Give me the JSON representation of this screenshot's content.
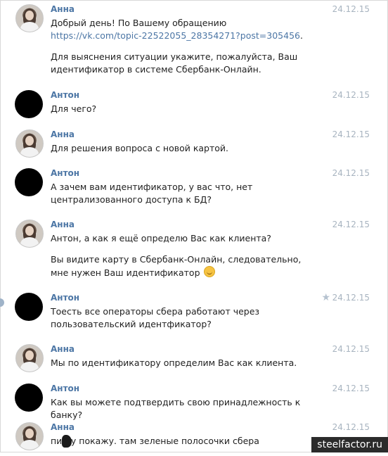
{
  "messages": [
    {
      "author": "Анна",
      "date": "24.12.15",
      "lines": [
        {
          "pre": "Добрый день! По Вашему обращению ",
          "link": "https://vk.com/topic-22522055_28354271?post=305456",
          "post": "."
        },
        {
          "text": "Для выяснения ситуации укажите, пожалуйста, Ваш идентификатор в системе Сбербанк-Онлайн."
        }
      ]
    },
    {
      "author": "Антон",
      "date": "24.12.15",
      "lines": [
        {
          "text": "Для чего?"
        }
      ]
    },
    {
      "author": "Анна",
      "date": "24.12.15",
      "lines": [
        {
          "text": "Для решения вопроса с новой картой."
        }
      ]
    },
    {
      "author": "Антон",
      "date": "24.12.15",
      "lines": [
        {
          "text": "А зачем вам идентификатор, у вас что, нет централизованного доступа к БД?"
        }
      ]
    },
    {
      "author": "Анна",
      "date": "24.12.15",
      "lines": [
        {
          "text": "Антон, а как я ещё определю Вас как клиента?"
        },
        {
          "text": "Вы видите карту в Сбербанк-Онлайн, следовательно, мне нужен Ваш идентификатор",
          "emoji": "smile-emoji"
        }
      ]
    },
    {
      "author": "Антон",
      "date": "24.12.15",
      "starred": true,
      "lines": [
        {
          "text": "Тоесть все операторы сбера работают через пользовательский идентфикатор?"
        }
      ]
    },
    {
      "author": "Анна",
      "date": "24.12.15",
      "lines": [
        {
          "text": "Мы по идентификатору определим Вас как клиента."
        }
      ]
    },
    {
      "author": "Антон",
      "date": "24.12.15",
      "lines": [
        {
          "text": "Как вы можете подтвердить свою принадлежность к банку?"
        }
      ]
    },
    {
      "author": "Анна",
      "date": "24.12.15",
      "lines": [
        {
          "text": "пи  ду покажу. там зеленые полосочки сбера"
        }
      ]
    }
  ],
  "watermark": "steelfactor.ru",
  "colors": {
    "author": "#4c76a5",
    "date": "#a8b4c0",
    "text": "#1f1f1f",
    "link": "#4c76a5"
  },
  "icons": {
    "star": "star-icon",
    "emoji": "smile-emoji"
  }
}
